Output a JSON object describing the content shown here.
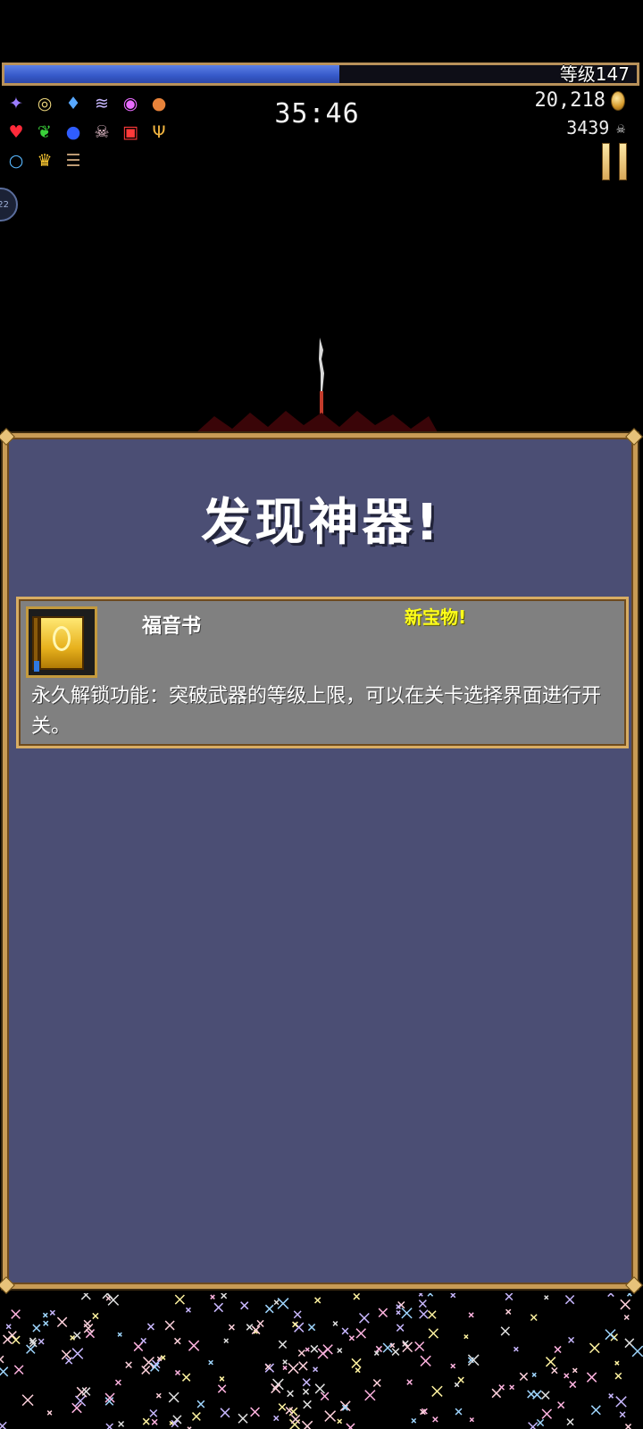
{
  "hud": {
    "level_label": "等级147",
    "xp_fraction": 0.53,
    "timer": "35:46",
    "gold": "20,218",
    "kills": "3439",
    "side_badge": "22"
  },
  "inventory": {
    "rows": [
      [
        "spellbook-icon",
        "clock-icon",
        "holy-water-icon",
        "whip-icon",
        "target-icon",
        "fireball-icon"
      ],
      [
        "heart-icon",
        "leaf-icon",
        "orb-icon",
        "skull-icon",
        "tome-icon",
        "candelabra-icon"
      ],
      [
        "ring-icon",
        "crown-icon",
        "book-stack-icon"
      ]
    ],
    "glyphs": {
      "spellbook-icon": "✦",
      "clock-icon": "◎",
      "holy-water-icon": "♦",
      "whip-icon": "≋",
      "target-icon": "◉",
      "fireball-icon": "●",
      "heart-icon": "♥",
      "leaf-icon": "❦",
      "orb-icon": "●",
      "skull-icon": "☠",
      "tome-icon": "▣",
      "candelabra-icon": "Ψ",
      "ring-icon": "○",
      "crown-icon": "♛",
      "book-stack-icon": "☰"
    },
    "colors": {
      "spellbook-icon": "#9b7cff",
      "clock-icon": "#e8d27a",
      "holy-water-icon": "#58a8ff",
      "whip-icon": "#c8b8ff",
      "target-icon": "#e96cff",
      "fireball-icon": "#e8833a",
      "heart-icon": "#ff2a3a",
      "leaf-icon": "#3ad13a",
      "orb-icon": "#2f5dff",
      "skull-icon": "#f2c8d6",
      "tome-icon": "#ff3a3a",
      "candelabra-icon": "#f2b540",
      "ring-icon": "#58b8ff",
      "crown-icon": "#ffcc33",
      "book-stack-icon": "#c7a37a"
    }
  },
  "dialog": {
    "title": "发现神器!",
    "item": {
      "name": "福音书",
      "tag": "新宝物!",
      "description": "永久解锁功能：突破武器的等级上限，可以在关卡选择界面进行开关。"
    }
  },
  "colors": {
    "panel_bg": "#4b4e74",
    "panel_border": "#c89b55",
    "card_bg": "#808080",
    "xp_blue": "#3558c8",
    "new_tag": "#ffff1a"
  }
}
